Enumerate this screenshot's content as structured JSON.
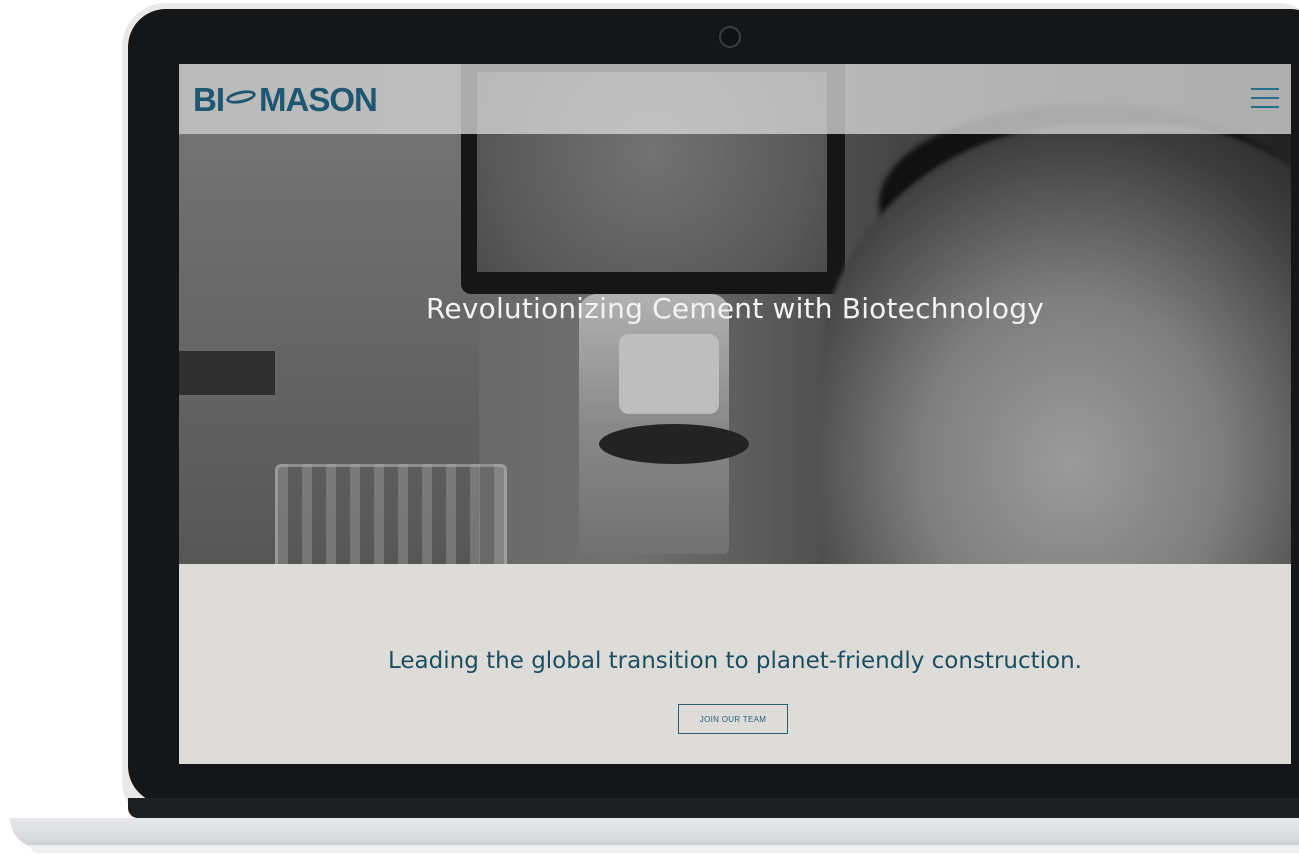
{
  "brand": {
    "logo_left": "BI",
    "logo_right": "MASON",
    "color": "#1f5672"
  },
  "header": {
    "menu_icon": "hamburger-menu-icon"
  },
  "hero": {
    "title": "Revolutionizing Cement with Biotechnology"
  },
  "cta_section": {
    "tagline": "Leading the global transition to planet-friendly construction.",
    "button_label": "JOIN OUR TEAM"
  },
  "colors": {
    "accent": "#1f5672",
    "section_background": "#dedcd8",
    "device_frame": "#141617"
  }
}
